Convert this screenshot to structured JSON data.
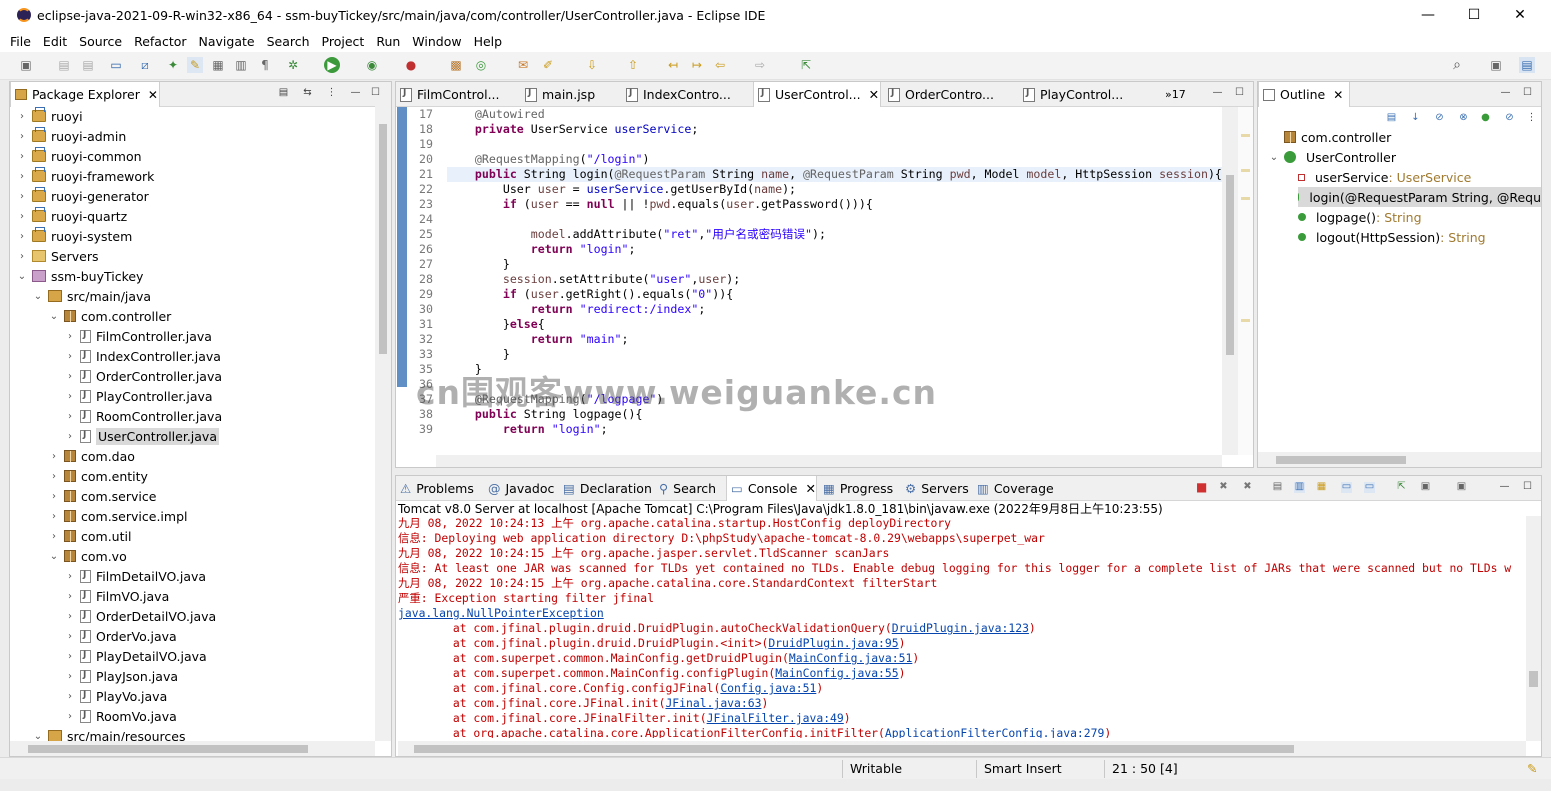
{
  "window": {
    "title": "eclipse-java-2021-09-R-win32-x86_64 - ssm-buyTickey/src/main/java/com/controller/UserController.java - Eclipse IDE",
    "minimize": "—",
    "maximize": "☐",
    "close": "✕"
  },
  "menu": [
    "File",
    "Edit",
    "Source",
    "Refactor",
    "Navigate",
    "Search",
    "Project",
    "Run",
    "Window",
    "Help"
  ],
  "package_explorer": {
    "tab_label": "Package Explorer",
    "items": [
      {
        "label": "ruoyi",
        "depth": 0,
        "chev": "›",
        "icon": "proj"
      },
      {
        "label": "ruoyi-admin",
        "depth": 0,
        "chev": "›",
        "icon": "proj"
      },
      {
        "label": "ruoyi-common",
        "depth": 0,
        "chev": "›",
        "icon": "proj"
      },
      {
        "label": "ruoyi-framework",
        "depth": 0,
        "chev": "›",
        "icon": "proj"
      },
      {
        "label": "ruoyi-generator",
        "depth": 0,
        "chev": "›",
        "icon": "proj"
      },
      {
        "label": "ruoyi-quartz",
        "depth": 0,
        "chev": "›",
        "icon": "proj"
      },
      {
        "label": "ruoyi-system",
        "depth": 0,
        "chev": "›",
        "icon": "proj"
      },
      {
        "label": "Servers",
        "depth": 0,
        "chev": "›",
        "icon": "srv"
      },
      {
        "label": "ssm-buyTickey",
        "depth": 0,
        "chev": "⌄",
        "icon": "web"
      },
      {
        "label": "src/main/java",
        "depth": 1,
        "chev": "⌄",
        "icon": "src"
      },
      {
        "label": "com.controller",
        "depth": 2,
        "chev": "⌄",
        "icon": "pkg"
      },
      {
        "label": "FilmController.java",
        "depth": 3,
        "chev": "›",
        "icon": "jfile"
      },
      {
        "label": "IndexController.java",
        "depth": 3,
        "chev": "›",
        "icon": "jfile"
      },
      {
        "label": "OrderController.java",
        "depth": 3,
        "chev": "›",
        "icon": "jfile"
      },
      {
        "label": "PlayController.java",
        "depth": 3,
        "chev": "›",
        "icon": "jfile"
      },
      {
        "label": "RoomController.java",
        "depth": 3,
        "chev": "›",
        "icon": "jfile"
      },
      {
        "label": "UserController.java",
        "depth": 3,
        "chev": "›",
        "icon": "jfile",
        "selected": true
      },
      {
        "label": "com.dao",
        "depth": 2,
        "chev": "›",
        "icon": "pkg"
      },
      {
        "label": "com.entity",
        "depth": 2,
        "chev": "›",
        "icon": "pkg"
      },
      {
        "label": "com.service",
        "depth": 2,
        "chev": "›",
        "icon": "pkg"
      },
      {
        "label": "com.service.impl",
        "depth": 2,
        "chev": "›",
        "icon": "pkg"
      },
      {
        "label": "com.util",
        "depth": 2,
        "chev": "›",
        "icon": "pkg"
      },
      {
        "label": "com.vo",
        "depth": 2,
        "chev": "⌄",
        "icon": "pkg"
      },
      {
        "label": "FilmDetailVO.java",
        "depth": 3,
        "chev": "›",
        "icon": "jfile"
      },
      {
        "label": "FilmVO.java",
        "depth": 3,
        "chev": "›",
        "icon": "jfile"
      },
      {
        "label": "OrderDetailVO.java",
        "depth": 3,
        "chev": "›",
        "icon": "jfile"
      },
      {
        "label": "OrderVo.java",
        "depth": 3,
        "chev": "›",
        "icon": "jfile"
      },
      {
        "label": "PlayDetailVO.java",
        "depth": 3,
        "chev": "›",
        "icon": "jfile"
      },
      {
        "label": "PlayJson.java",
        "depth": 3,
        "chev": "›",
        "icon": "jfile"
      },
      {
        "label": "PlayVo.java",
        "depth": 3,
        "chev": "›",
        "icon": "jfile"
      },
      {
        "label": "RoomVo.java",
        "depth": 3,
        "chev": "›",
        "icon": "jfile"
      },
      {
        "label": "src/main/resources",
        "depth": 1,
        "chev": "⌄",
        "icon": "src"
      }
    ]
  },
  "editor": {
    "tabs": [
      {
        "label": "FilmControl...",
        "active": false
      },
      {
        "label": "main.jsp",
        "active": false
      },
      {
        "label": "IndexContro...",
        "active": false
      },
      {
        "label": "UserControl...",
        "active": true
      },
      {
        "label": "OrderContro...",
        "active": false
      },
      {
        "label": "PlayControl...",
        "active": false
      }
    ],
    "overflow": "»17",
    "lines": [
      {
        "n": "17",
        "text": "    @Autowired"
      },
      {
        "n": "18",
        "text": "    private UserService userService;"
      },
      {
        "n": "19",
        "text": ""
      },
      {
        "n": "20",
        "text": "    @RequestMapping(\"/login\")"
      },
      {
        "n": "21",
        "text": "    public String login(@RequestParam String name, @RequestParam String pwd, Model model, HttpSession session){"
      },
      {
        "n": "22",
        "text": "        User user = userService.getUserById(name);"
      },
      {
        "n": "23",
        "text": "        if (user == null || !pwd.equals(user.getPassword())){"
      },
      {
        "n": "24",
        "text": ""
      },
      {
        "n": "25",
        "text": "            model.addAttribute(\"ret\",\"用户名或密码错误\");"
      },
      {
        "n": "26",
        "text": "            return \"login\";"
      },
      {
        "n": "27",
        "text": "        }"
      },
      {
        "n": "28",
        "text": "        session.setAttribute(\"user\",user);"
      },
      {
        "n": "29",
        "text": "        if (user.getRight().equals(\"0\")){"
      },
      {
        "n": "30",
        "text": "            return \"redirect:/index\";"
      },
      {
        "n": "31",
        "text": "        }else{"
      },
      {
        "n": "32",
        "text": "            return \"main\";"
      },
      {
        "n": "33",
        "text": "        }"
      },
      {
        "n": "35",
        "text": "    }"
      },
      {
        "n": "36",
        "text": ""
      },
      {
        "n": "37",
        "text": "    @RequestMapping(\"/logpage\")"
      },
      {
        "n": "38",
        "text": "    public String logpage(){"
      },
      {
        "n": "39",
        "text": "        return \"login\";"
      }
    ],
    "watermark": "cn围观客www.weiguanke.cn"
  },
  "outline": {
    "tab_label": "Outline",
    "items": [
      {
        "label": "com.controller",
        "type": "",
        "depth": 0,
        "icon": "pkg"
      },
      {
        "label": "UserController",
        "type": "",
        "depth": 0,
        "icon": "class",
        "chev": "⌄"
      },
      {
        "label": "userService",
        "type": " : UserService",
        "depth": 1,
        "icon": "field"
      },
      {
        "label": "login(@RequestParam String, @Requ",
        "type": "",
        "depth": 1,
        "icon": "method",
        "selected": true
      },
      {
        "label": "logpage()",
        "type": " : String",
        "depth": 1,
        "icon": "method"
      },
      {
        "label": "logout(HttpSession)",
        "type": " : String",
        "depth": 1,
        "icon": "method"
      }
    ]
  },
  "console": {
    "tabs": [
      {
        "label": "Problems",
        "icon": "⚠"
      },
      {
        "label": "Javadoc",
        "icon": "@"
      },
      {
        "label": "Declaration",
        "icon": "▤"
      },
      {
        "label": "Search",
        "icon": "⚲"
      },
      {
        "label": "Console",
        "icon": "▭",
        "active": true
      },
      {
        "label": "Progress",
        "icon": "▦"
      },
      {
        "label": "Servers",
        "icon": "⚙"
      },
      {
        "label": "Coverage",
        "icon": "▥"
      }
    ],
    "header": "Tomcat v8.0 Server at localhost [Apache Tomcat] C:\\Program Files\\Java\\jdk1.8.0_181\\bin\\javaw.exe  (2022年9月8日上午10:23:55)",
    "lines": [
      {
        "text": "九月 08, 2022 10:24:13 上午 org.apache.catalina.startup.HostConfig deployDirectory",
        "cls": "red"
      },
      {
        "text": "信息: Deploying web application directory D:\\phpStudy\\apache-tomcat-8.0.29\\webapps\\superpet_war",
        "cls": "red"
      },
      {
        "text": "九月 08, 2022 10:24:15 上午 org.apache.jasper.servlet.TldScanner scanJars",
        "cls": "red"
      },
      {
        "text": "信息: At least one JAR was scanned for TLDs yet contained no TLDs. Enable debug logging for this logger for a complete list of JARs that were scanned but no TLDs w",
        "cls": "red"
      },
      {
        "text": "九月 08, 2022 10:24:15 上午 org.apache.catalina.core.StandardContext filterStart",
        "cls": "red"
      },
      {
        "text": "严重: Exception starting filter jfinal",
        "cls": "red"
      },
      {
        "text": "java.lang.NullPointerException",
        "cls": "lnk"
      },
      {
        "text": "        at com.jfinal.plugin.druid.DruidPlugin.autoCheckValidationQuery(",
        "link": "DruidPlugin.java:123",
        "tail": ")"
      },
      {
        "text": "        at com.jfinal.plugin.druid.DruidPlugin.<init>(",
        "link": "DruidPlugin.java:95",
        "tail": ")"
      },
      {
        "text": "        at com.superpet.common.MainConfig.getDruidPlugin(",
        "link": "MainConfig.java:51",
        "tail": ")"
      },
      {
        "text": "        at com.superpet.common.MainConfig.configPlugin(",
        "link": "MainConfig.java:55",
        "tail": ")"
      },
      {
        "text": "        at com.jfinal.core.Config.configJFinal(",
        "link": "Config.java:51",
        "tail": ")"
      },
      {
        "text": "        at com.jfinal.core.JFinal.init(",
        "link": "JFinal.java:63",
        "tail": ")"
      },
      {
        "text": "        at com.jfinal.core.JFinalFilter.init(",
        "link": "JFinalFilter.java:49",
        "tail": ")"
      },
      {
        "text": "        at org.apache.catalina.core.ApplicationFilterConfig.initFilter(",
        "link": "ApplicationFilterConfig.java:279",
        "tail": ")"
      }
    ]
  },
  "statusbar": {
    "writable": "Writable",
    "insert_mode": "Smart Insert",
    "position": "21 : 50 [4]"
  },
  "colors": {
    "keyword": "#7f0055",
    "string": "#2a00ff",
    "field": "#0000c0",
    "console_error": "#c00000",
    "link": "#0645ad"
  }
}
